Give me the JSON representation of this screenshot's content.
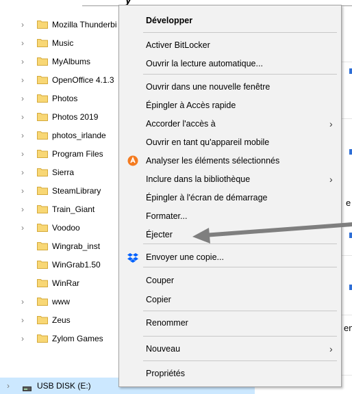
{
  "window": {
    "partial_title_glyph": "y"
  },
  "tree": {
    "items": [
      {
        "label": "Mozilla Thunderbi",
        "expandable": true
      },
      {
        "label": "Music",
        "expandable": true
      },
      {
        "label": "MyAlbums",
        "expandable": true
      },
      {
        "label": "OpenOffice 4.1.3",
        "expandable": true
      },
      {
        "label": "Photos",
        "expandable": true
      },
      {
        "label": "Photos 2019",
        "expandable": true
      },
      {
        "label": "photos_irlande",
        "expandable": true
      },
      {
        "label": "Program Files",
        "expandable": true
      },
      {
        "label": "Sierra",
        "expandable": true
      },
      {
        "label": "SteamLibrary",
        "expandable": true
      },
      {
        "label": "Train_Giant",
        "expandable": true
      },
      {
        "label": "Voodoo",
        "expandable": true
      },
      {
        "label": "Wingrab_inst",
        "expandable": false
      },
      {
        "label": "WinGrab1.50",
        "expandable": false
      },
      {
        "label": "WinRar",
        "expandable": false
      },
      {
        "label": "www",
        "expandable": true
      },
      {
        "label": "Zeus",
        "expandable": true
      },
      {
        "label": "Zylom Games",
        "expandable": true
      }
    ],
    "usb": {
      "label": "USB DISK (E:)",
      "icon": "usb-drive-icon"
    }
  },
  "context_menu": {
    "items": [
      {
        "label": "Développer",
        "bold": true
      },
      {
        "label": "Activer BitLocker"
      },
      {
        "label": "Ouvrir la lecture automatique..."
      },
      {
        "label": "Ouvrir dans une nouvelle fenêtre"
      },
      {
        "label": "Épingler à Accès rapide"
      },
      {
        "label": "Accorder l'accès à",
        "submenu": true
      },
      {
        "label": "Ouvrir en tant qu'appareil mobile"
      },
      {
        "label": "Analyser les éléments sélectionnés",
        "icon": "avast-icon"
      },
      {
        "label": "Inclure dans la bibliothèque",
        "submenu": true
      },
      {
        "label": "Épingler à l'écran de démarrage"
      },
      {
        "label": "Formater..."
      },
      {
        "label": "Éjecter"
      },
      {
        "label": "Envoyer une copie...",
        "icon": "dropbox-icon"
      },
      {
        "label": "Couper"
      },
      {
        "label": "Copier"
      },
      {
        "label": "Renommer"
      },
      {
        "label": "Nouveau",
        "submenu": true
      },
      {
        "label": "Propriétés"
      }
    ]
  },
  "right_fragments": [
    "e",
    "en"
  ],
  "colors": {
    "folder": "#f8d775",
    "selection": "#cce8ff",
    "menu_bg": "#f2f2f2",
    "annotation_arrow": "#7f7f7f",
    "avast": "#f47b20",
    "dropbox": "#0061fe"
  }
}
